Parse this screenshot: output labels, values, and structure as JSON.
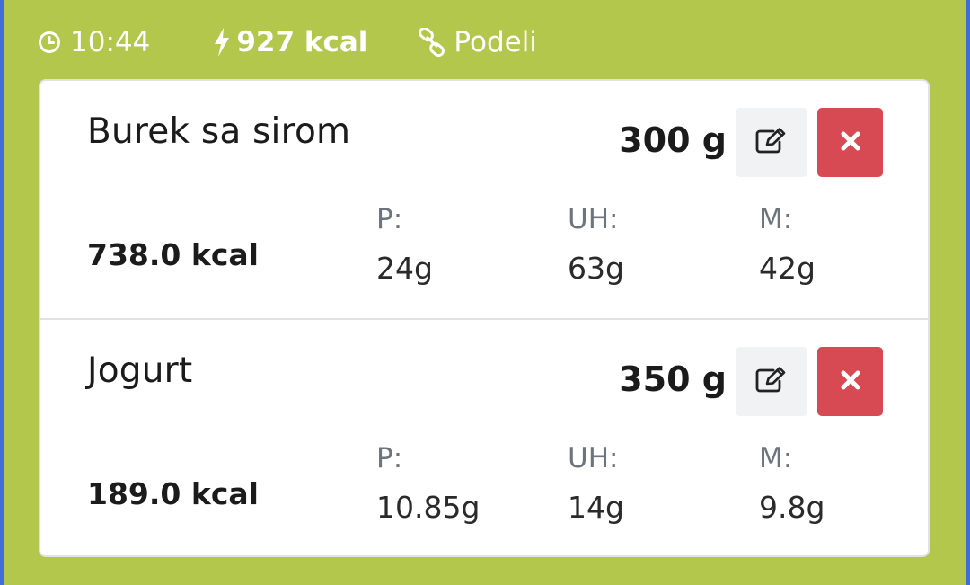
{
  "meal_header": {
    "time": "10:44",
    "total_kcal": "927 kcal",
    "share_label": "Podeli"
  },
  "icons": {
    "time": "clock-icon",
    "energy": "lightning-icon",
    "share": "link-icon",
    "edit": "edit-icon",
    "delete": "close-icon"
  },
  "colors": {
    "background": "#b3c74d",
    "delete_button": "#d84a53",
    "edit_button": "#f1f2f4"
  },
  "macro_labels": {
    "protein": "P:",
    "carbs": "UH:",
    "fat": "M:"
  },
  "foods": [
    {
      "name": "Burek sa sirom",
      "weight": "300 g",
      "kcal": "738.0 kcal",
      "protein": "24g",
      "carbs": "63g",
      "fat": "42g"
    },
    {
      "name": "Jogurt",
      "weight": "350 g",
      "kcal": "189.0 kcal",
      "protein": "10.85g",
      "carbs": "14g",
      "fat": "9.8g"
    }
  ]
}
